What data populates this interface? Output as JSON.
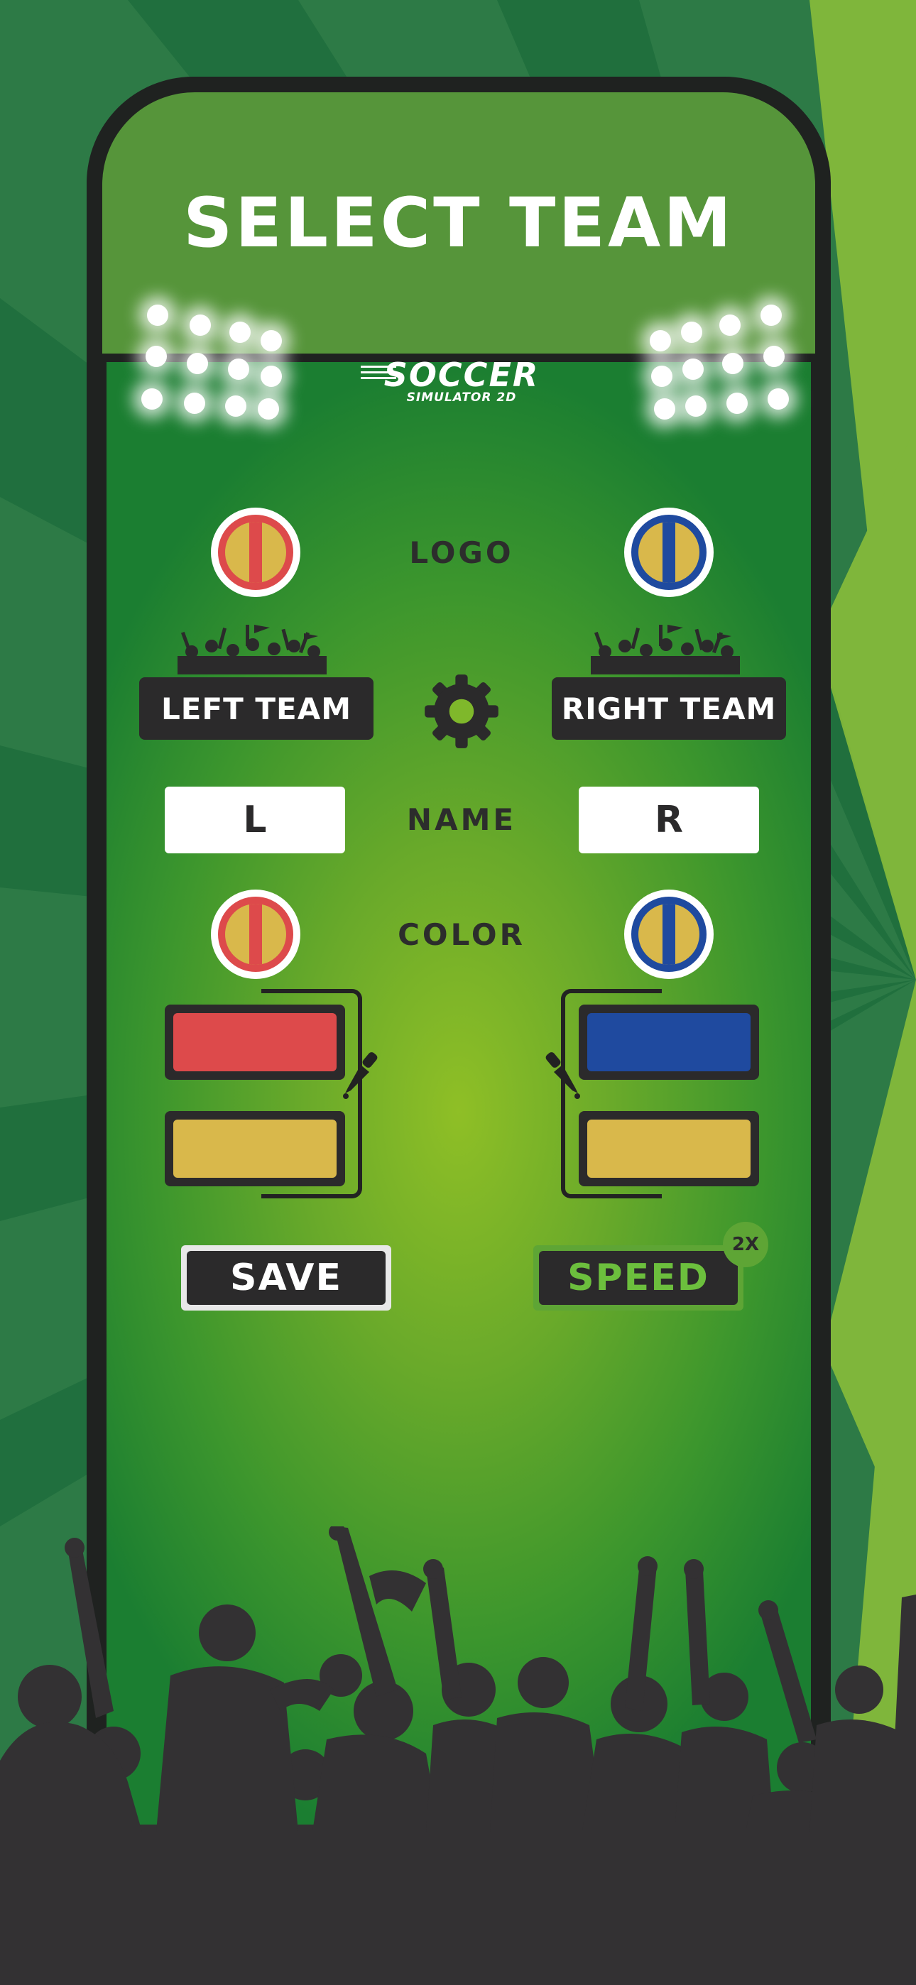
{
  "header": {
    "title": "SELECT TEAM"
  },
  "game_logo": {
    "name": "SOCCER",
    "subtitle": "SIMULATOR 2D"
  },
  "labels": {
    "logo": "LOGO",
    "name": "NAME",
    "color": "COLOR"
  },
  "left_team": {
    "button_label": "LEFT TEAM",
    "name_value": "L",
    "primary_color": "#dd4a4b",
    "secondary_color": "#d9b84b"
  },
  "right_team": {
    "button_label": "RIGHT TEAM",
    "name_value": "R",
    "primary_color": "#1f4a9f",
    "secondary_color": "#d9b84b"
  },
  "actions": {
    "save_label": "SAVE",
    "speed_label": "SPEED",
    "speed_badge": "2X"
  },
  "icons": [
    "settings-gear-icon",
    "eyedropper-icon",
    "stadium-lights",
    "crowd-silhouette"
  ],
  "theme": {
    "accent_green": "#56953a",
    "dark": "#2b2a2b",
    "speed_text": "#6cbf3d"
  }
}
